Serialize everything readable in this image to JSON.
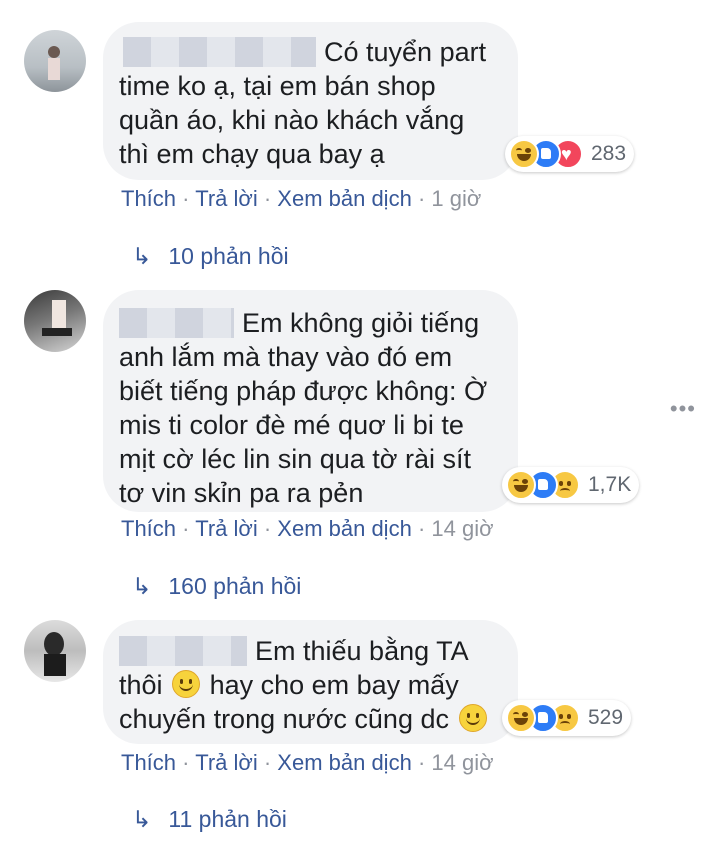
{
  "comments": [
    {
      "text_lines": [
        "Có tuyển part",
        "time ko ạ, tại em bán shop",
        "quần áo, khi nào khách vắng",
        "thì em chạy qua bay ạ"
      ],
      "reactions": [
        "haha",
        "like",
        "love"
      ],
      "reaction_count": "283",
      "actions": {
        "like": "Thích",
        "reply": "Trả lời",
        "translate": "Xem bản dịch",
        "time": "1 giờ"
      },
      "replies_label": "10 phản hồi"
    },
    {
      "text_lines": [
        "Em không giỏi tiếng",
        "anh lắm mà thay vào đó em",
        "biết tiếng pháp được không: Ờ",
        "mis ti color đè mé quơ li bi te",
        "mịt cờ léc lin sin qua tờ rài sít",
        "tơ vin skỉn pa ra pẻn"
      ],
      "reactions": [
        "haha",
        "like",
        "sad"
      ],
      "reaction_count": "1,7K",
      "actions": {
        "like": "Thích",
        "reply": "Trả lời",
        "translate": "Xem bản dịch",
        "time": "14 giờ"
      },
      "replies_label": "160 phản hồi"
    },
    {
      "text_lines": [
        "Em thiếu bằng TA",
        "thôi",
        "hay cho em bay mấy",
        "chuyến trong nước cũng dc"
      ],
      "reactions": [
        "haha",
        "like",
        "sad"
      ],
      "reaction_count": "529",
      "actions": {
        "like": "Thích",
        "reply": "Trả lời",
        "translate": "Xem bản dịch",
        "time": "14 giờ"
      },
      "replies_label": "11 phản hồi"
    }
  ],
  "separator": "·",
  "reply_arrow_icon": "reply-arrow-icon",
  "more_icon": "more-options-icon",
  "colors": {
    "link": "#385898",
    "bubble": "#f2f3f5",
    "meta": "#90949c"
  }
}
